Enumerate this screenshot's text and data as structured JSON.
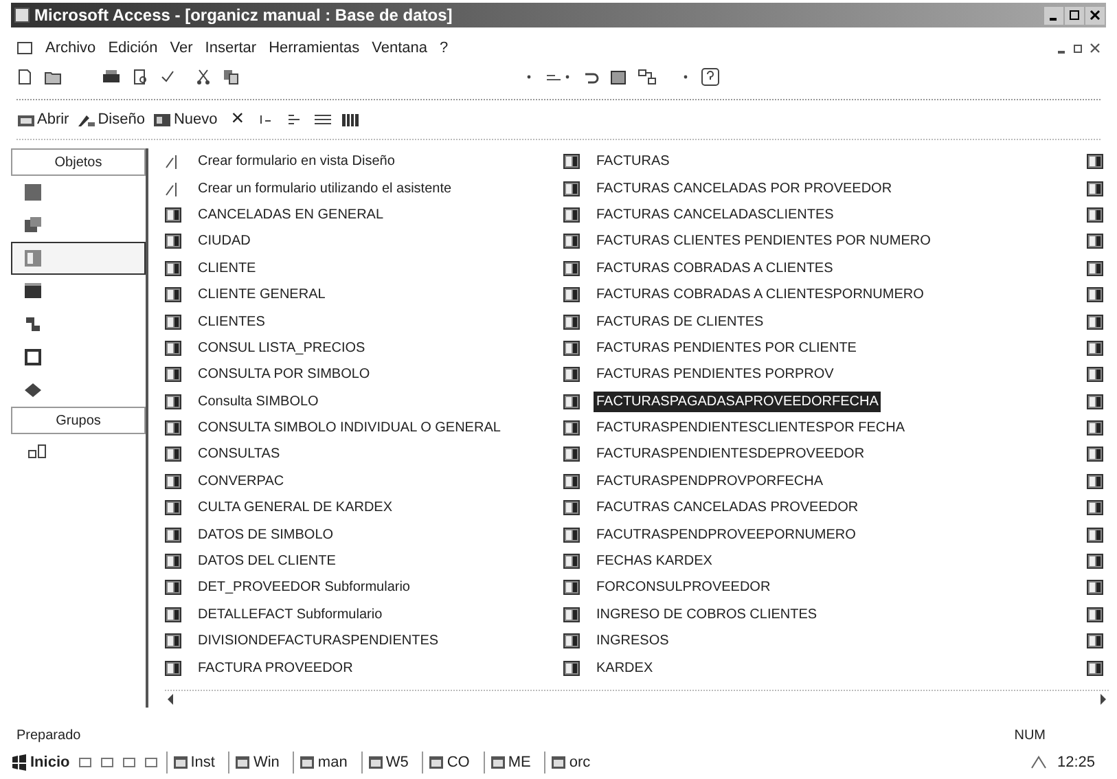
{
  "window": {
    "title": "Microsoft Access - [organicz manual : Base de datos]"
  },
  "menu": [
    "Archivo",
    "Edición",
    "Ver",
    "Insertar",
    "Herramientas",
    "Ventana",
    "?"
  ],
  "db_toolbar": [
    {
      "kind": "open",
      "label": "Abrir"
    },
    {
      "kind": "design",
      "label": "Diseño"
    },
    {
      "kind": "new",
      "label": "Nuevo"
    },
    {
      "kind": "delete",
      "label": "×"
    }
  ],
  "sidebar": {
    "objects_button": "Objetos",
    "objects": [
      {
        "selected": false
      },
      {
        "selected": false
      },
      {
        "selected": true
      },
      {
        "selected": false
      },
      {
        "selected": false
      },
      {
        "selected": false
      },
      {
        "selected": false
      }
    ],
    "groups_button": "Grupos"
  },
  "items": [
    {
      "kind": "wizard",
      "label": "Crear formulario en vista Diseño",
      "selected": false
    },
    {
      "kind": "wizard",
      "label": "Crear un formulario utilizando el asistente",
      "selected": false
    },
    {
      "kind": "form",
      "label": "CANCELADAS EN GENERAL",
      "selected": false
    },
    {
      "kind": "form",
      "label": "CIUDAD",
      "selected": false
    },
    {
      "kind": "form",
      "label": "CLIENTE",
      "selected": false
    },
    {
      "kind": "form",
      "label": "CLIENTE GENERAL",
      "selected": false
    },
    {
      "kind": "form",
      "label": "CLIENTES",
      "selected": false
    },
    {
      "kind": "form",
      "label": "CONSUL LISTA_PRECIOS",
      "selected": false
    },
    {
      "kind": "form",
      "label": "CONSULTA POR SIMBOLO",
      "selected": false
    },
    {
      "kind": "form",
      "label": "Consulta SIMBOLO",
      "selected": false
    },
    {
      "kind": "form",
      "label": "CONSULTA SIMBOLO INDIVIDUAL O GENERAL",
      "selected": false
    },
    {
      "kind": "form",
      "label": "CONSULTAS",
      "selected": false
    },
    {
      "kind": "form",
      "label": "CONVERPAC",
      "selected": false
    },
    {
      "kind": "form",
      "label": "CULTA GENERAL DE KARDEX",
      "selected": false
    },
    {
      "kind": "form",
      "label": "DATOS DE SIMBOLO",
      "selected": false
    },
    {
      "kind": "form",
      "label": "DATOS DEL CLIENTE",
      "selected": false
    },
    {
      "kind": "form",
      "label": "DET_PROVEEDOR Subformulario",
      "selected": false
    },
    {
      "kind": "form",
      "label": "DETALLEFACT Subformulario",
      "selected": false
    },
    {
      "kind": "form",
      "label": "DIVISIONDEFACTURASPENDIENTES",
      "selected": false
    },
    {
      "kind": "form",
      "label": "FACTURA PROVEEDOR",
      "selected": false
    },
    {
      "kind": "form",
      "label": "FACTURAS",
      "selected": false
    },
    {
      "kind": "form",
      "label": "FACTURAS CANCELADAS POR PROVEEDOR",
      "selected": false
    },
    {
      "kind": "form",
      "label": "FACTURAS CANCELADASCLIENTES",
      "selected": false
    },
    {
      "kind": "form",
      "label": "FACTURAS CLIENTES PENDIENTES POR NUMERO",
      "selected": false
    },
    {
      "kind": "form",
      "label": "FACTURAS COBRADAS A CLIENTES",
      "selected": false
    },
    {
      "kind": "form",
      "label": "FACTURAS COBRADAS A CLIENTESPORNUMERO",
      "selected": false
    },
    {
      "kind": "form",
      "label": "FACTURAS DE CLIENTES",
      "selected": false
    },
    {
      "kind": "form",
      "label": "FACTURAS PENDIENTES POR CLIENTE",
      "selected": false
    },
    {
      "kind": "form",
      "label": "FACTURAS PENDIENTES PORPROV",
      "selected": false
    },
    {
      "kind": "form",
      "label": "FACTURASPAGADASAPROVEEDORFECHA",
      "selected": true
    },
    {
      "kind": "form",
      "label": "FACTURASPENDIENTESCLIENTESPOR FECHA",
      "selected": false
    },
    {
      "kind": "form",
      "label": "FACTURASPENDIENTESDEPROVEEDOR",
      "selected": false
    },
    {
      "kind": "form",
      "label": "FACTURASPENDPROVPORFECHA",
      "selected": false
    },
    {
      "kind": "form",
      "label": "FACUTRAS CANCELADAS PROVEEDOR",
      "selected": false
    },
    {
      "kind": "form",
      "label": "FACUTRASPENDPROVEEPORNUMERO",
      "selected": false
    },
    {
      "kind": "form",
      "label": "FECHAS KARDEX",
      "selected": false
    },
    {
      "kind": "form",
      "label": "FORCONSULPROVEEDOR",
      "selected": false
    },
    {
      "kind": "form",
      "label": "INGRESO DE COBROS CLIENTES",
      "selected": false
    },
    {
      "kind": "form",
      "label": "INGRESOS",
      "selected": false
    },
    {
      "kind": "form",
      "label": "KARDEX",
      "selected": false
    }
  ],
  "status_bar": {
    "message": "Preparado",
    "indicator": "NUM"
  },
  "taskbar": {
    "start": "Inicio",
    "tasks": [
      "Inst",
      "Win",
      "man",
      "W5",
      "CO",
      "ME",
      "orc"
    ],
    "clock": "12:25"
  }
}
